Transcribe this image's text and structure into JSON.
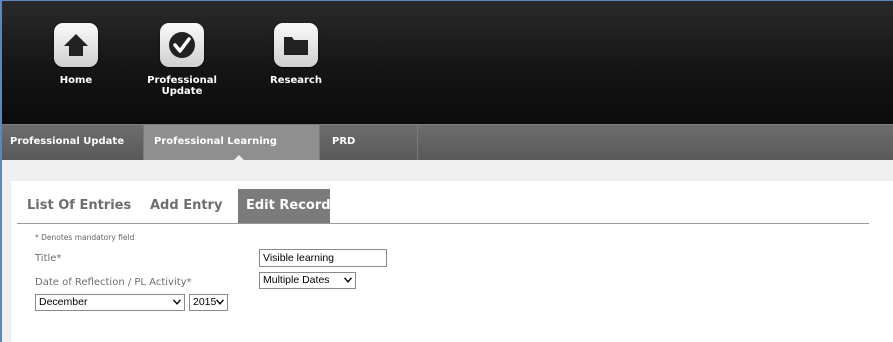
{
  "top_nav": {
    "items": [
      {
        "label": "Home",
        "icon": "home-icon"
      },
      {
        "label": "Professional Update",
        "icon": "checkmark-icon"
      },
      {
        "label": "Research",
        "icon": "folder-icon"
      }
    ]
  },
  "sub_nav": {
    "items": [
      {
        "label": "Professional Update"
      },
      {
        "label": "Professional Learning Record",
        "active": true
      },
      {
        "label": "PRD Meetings"
      }
    ]
  },
  "tabs": [
    {
      "label": "List Of Entries"
    },
    {
      "label": "Add Entry"
    },
    {
      "label": "Edit Record",
      "active": true
    }
  ],
  "form": {
    "mandatory_note": "* Denotes mandatory field",
    "title_label": "Title*",
    "title_value": "Visible learning",
    "date_label": "Date of Reflection / PL Activity*",
    "date_mode_value": "Multiple Dates",
    "month_value": "December",
    "year_value": "2015"
  },
  "colors": {
    "topbar": "#151515",
    "subnav": "#636363",
    "subnav_active": "#8f8f8f",
    "tab_active": "#7b7b7b",
    "frame_border": "#5b86c6"
  }
}
